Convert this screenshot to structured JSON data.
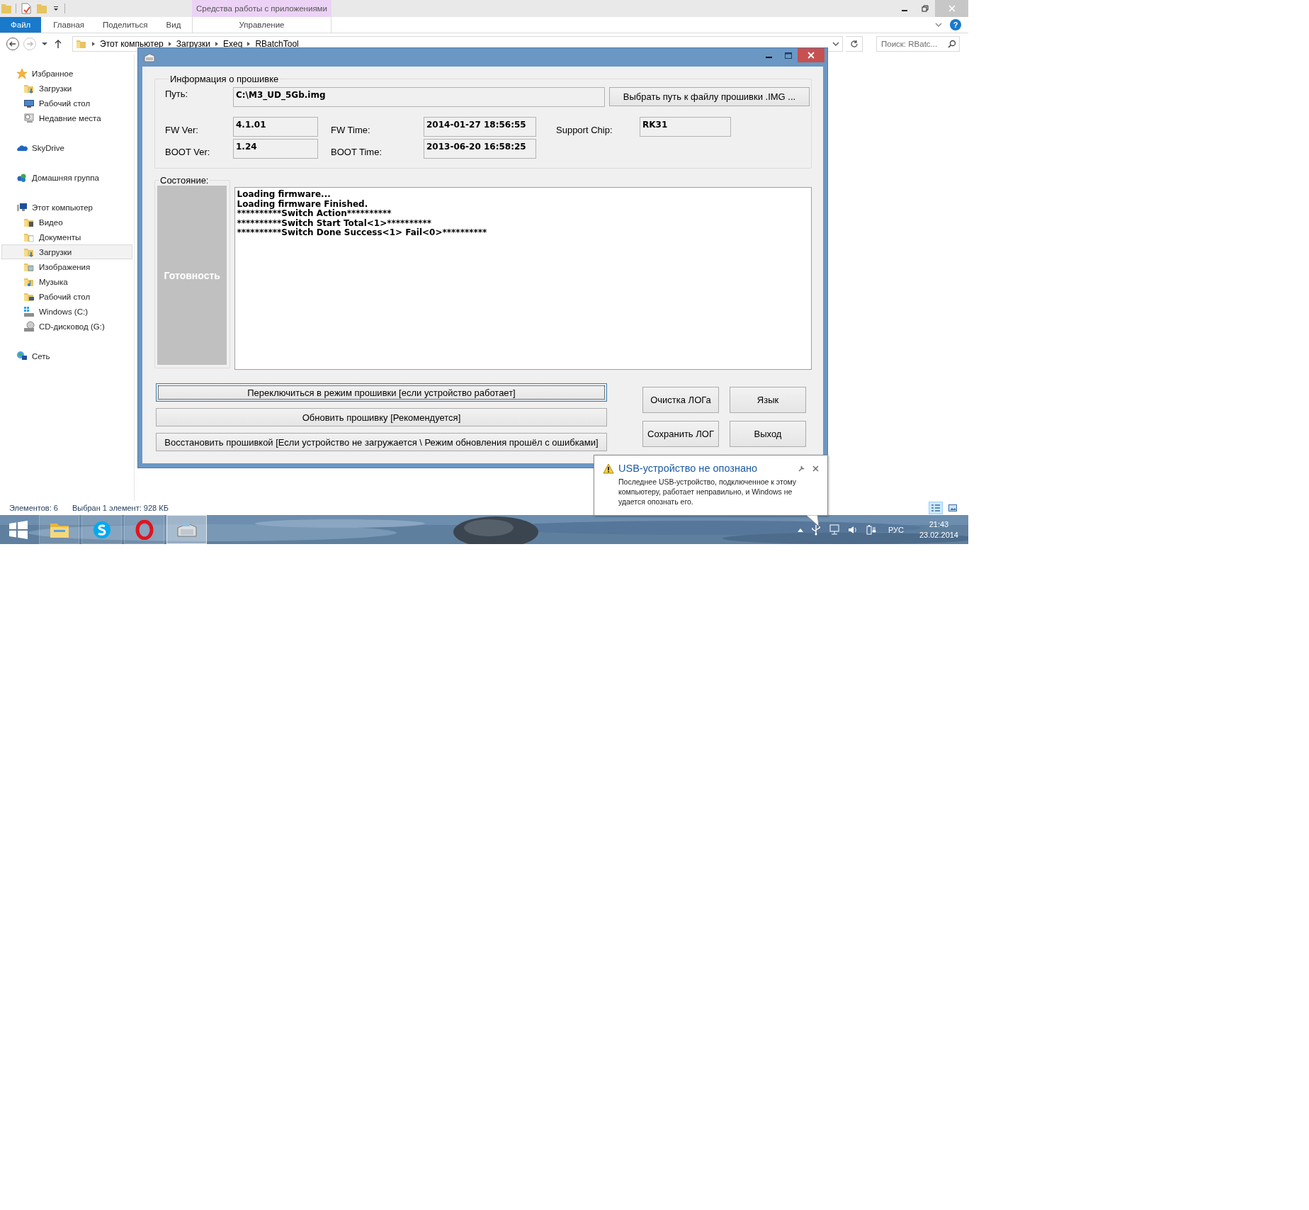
{
  "explorer": {
    "context_tab_group": "Средства работы с приложениями",
    "ribbon_tabs": [
      {
        "label": "Файл",
        "kind": "file",
        "selected": false
      },
      {
        "label": "Главная",
        "kind": "tab",
        "selected": false
      },
      {
        "label": "Поделиться",
        "kind": "tab",
        "selected": false
      },
      {
        "label": "Вид",
        "kind": "tab",
        "selected": false
      },
      {
        "label": "Управление",
        "kind": "context",
        "selected": false
      }
    ],
    "help_button": "?",
    "breadcrumbs": [
      "Этот компьютер",
      "Загрузки",
      "Exeg",
      "RBatchTool"
    ],
    "search": {
      "placeholder": "Поиск: RBatc..."
    },
    "sidebar": [
      {
        "label": "Избранное",
        "kind": "star",
        "selected": false,
        "children": [
          {
            "label": "Загрузки",
            "kind": "downloads",
            "selected": false
          },
          {
            "label": "Рабочий стол",
            "kind": "desktop",
            "selected": false
          },
          {
            "label": "Недавние места",
            "kind": "recent",
            "selected": false
          }
        ]
      },
      {
        "label": "SkyDrive",
        "kind": "cloud",
        "selected": false
      },
      {
        "label": "Домашняя группа",
        "kind": "homegroup",
        "selected": false
      },
      {
        "label": "Этот компьютер",
        "kind": "computer",
        "selected": false,
        "children": [
          {
            "label": "Видео",
            "kind": "video",
            "selected": false
          },
          {
            "label": "Документы",
            "kind": "documents",
            "selected": false
          },
          {
            "label": "Загрузки",
            "kind": "downloads",
            "selected": true
          },
          {
            "label": "Изображения",
            "kind": "pictures",
            "selected": false
          },
          {
            "label": "Музыка",
            "kind": "music",
            "selected": false
          },
          {
            "label": "Рабочий стол",
            "kind": "desktop-folder",
            "selected": false
          },
          {
            "label": "Windows (C:)",
            "kind": "drive",
            "selected": false
          },
          {
            "label": "CD-дисковод (G:)",
            "kind": "disc",
            "selected": false
          }
        ]
      },
      {
        "label": "Сеть",
        "kind": "network",
        "selected": false
      }
    ],
    "status_bar": {
      "item_count": "Элементов: 6",
      "selection": "Выбран 1 элемент: 928 КБ",
      "views": [
        {
          "kind": "details",
          "selected": true
        },
        {
          "kind": "large-icons",
          "selected": false
        }
      ]
    }
  },
  "dialog": {
    "info_group": {
      "title": "Информация о прошивке",
      "path_label": "Путь:",
      "path_value": "C:\\M3_UD_5Gb.img",
      "browse_button": "Выбрать путь к файлу прошивки .IMG ...",
      "rows": [
        [
          {
            "label": "FW Ver:",
            "value": "4.1.01"
          },
          {
            "label": "FW Time:",
            "value": "2014-01-27 18:56:55"
          },
          {
            "label": "Support Chip:",
            "value": "RK31"
          }
        ],
        [
          {
            "label": "BOOT Ver:",
            "value": "1.24"
          },
          {
            "label": "BOOT Time:",
            "value": "2013-06-20 16:58:25"
          }
        ]
      ]
    },
    "status_group": {
      "title": "Состояние:",
      "status": "Готовность"
    },
    "log": [
      "Loading firmware...",
      "Loading firmware Finished.",
      "**********Switch Action**********",
      "**********Switch Start Total<1>**********",
      "**********Switch Done Success<1> Fail<0>**********"
    ],
    "action_buttons": [
      {
        "label": "Переключиться в режим прошивки [если устройство работает]",
        "focused": true
      },
      {
        "label": "Обновить прошивку [Рекомендуется]",
        "focused": false
      },
      {
        "label": "Восстановить прошивкой [Если устройство не загружается \\ Режим обновления прошёл с ошибками]",
        "focused": false
      }
    ],
    "side_buttons": [
      "Очистка ЛОГа",
      "Язык",
      "Сохранить ЛОГ",
      "Выход"
    ]
  },
  "notification": {
    "title": "USB-устройство не опознано",
    "message": "Последнее USB-устройство, подключенное к этому компьютеру, работает неправильно, и Windows не удается опознать его."
  },
  "taskbar": {
    "apps": [
      {
        "kind": "explorer",
        "selected": false
      },
      {
        "kind": "skype",
        "selected": false
      },
      {
        "kind": "opera",
        "selected": false
      },
      {
        "kind": "tool",
        "selected": true
      }
    ],
    "language": "РУС",
    "time": "21:43",
    "date": "23.02.2014"
  }
}
